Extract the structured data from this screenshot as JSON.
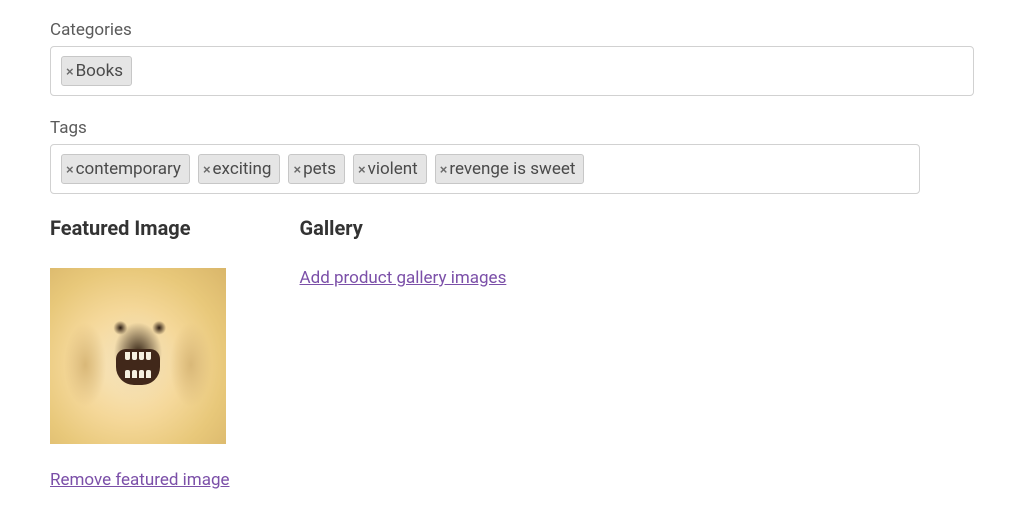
{
  "categories": {
    "label": "Categories",
    "items": [
      {
        "name": "Books"
      }
    ]
  },
  "tags": {
    "label": "Tags",
    "items": [
      {
        "name": "contemporary"
      },
      {
        "name": "exciting"
      },
      {
        "name": "pets"
      },
      {
        "name": "violent"
      },
      {
        "name": "revenge is sweet"
      }
    ]
  },
  "featured_image": {
    "heading": "Featured Image",
    "remove_link": "Remove featured image"
  },
  "gallery": {
    "heading": "Gallery",
    "add_link": "Add product gallery images"
  },
  "glyphs": {
    "close": "×"
  }
}
